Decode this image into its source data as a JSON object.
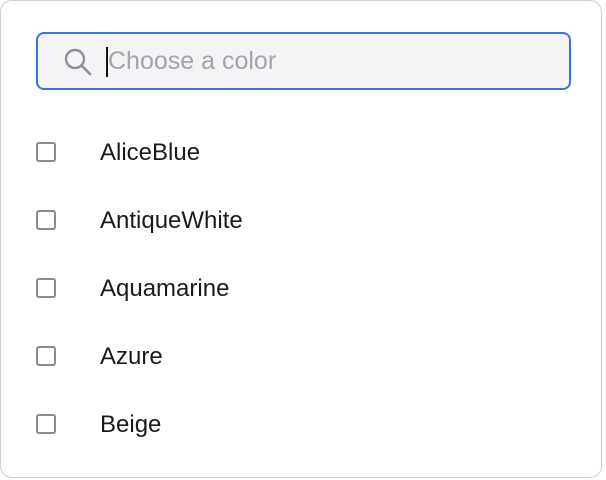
{
  "search": {
    "placeholder": "Choose a color",
    "value": "",
    "icon": "search-icon"
  },
  "options": [
    {
      "label": "AliceBlue",
      "checked": false
    },
    {
      "label": "AntiqueWhite",
      "checked": false
    },
    {
      "label": "Aquamarine",
      "checked": false
    },
    {
      "label": "Azure",
      "checked": false
    },
    {
      "label": "Beige",
      "checked": false
    }
  ],
  "colors": {
    "focus_border": "#3b73e0",
    "input_background": "#f4f4f6",
    "checkbox_border": "#8a8a8a",
    "text": "#1a1a1a",
    "placeholder": "#a3a3a8"
  }
}
